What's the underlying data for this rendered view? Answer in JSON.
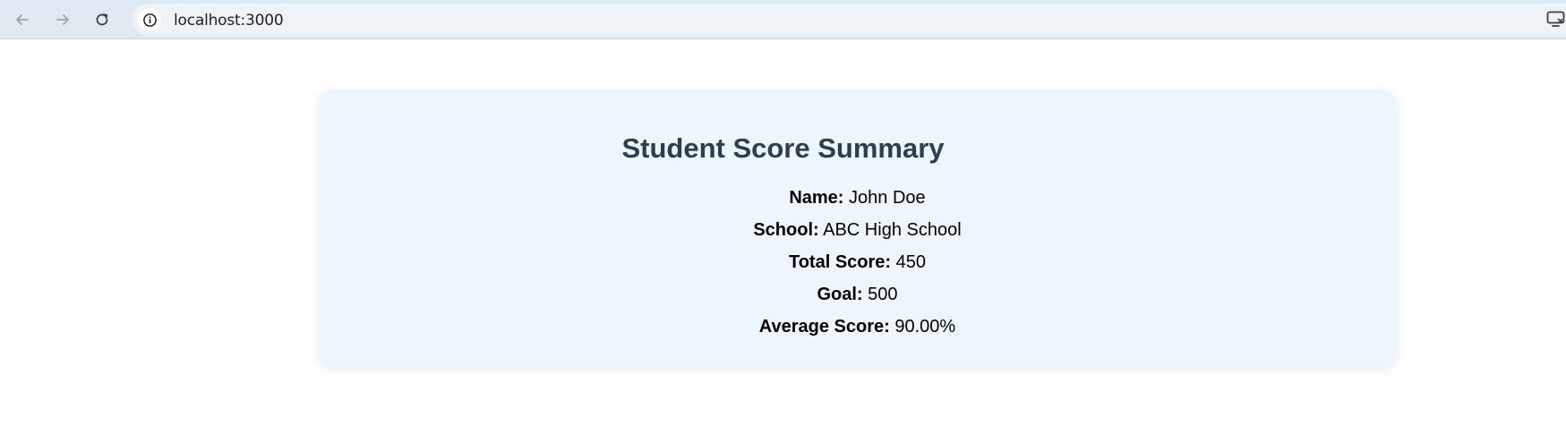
{
  "browser": {
    "url": "localhost:3000",
    "icons": {
      "back": "arrow-left-icon",
      "forward": "arrow-right-icon",
      "reload": "reload-icon",
      "site_info": "info-icon",
      "cast": "cast-icon"
    }
  },
  "card": {
    "title": "Student Score Summary",
    "rows": [
      {
        "label": "Name:",
        "value": "John Doe"
      },
      {
        "label": "School:",
        "value": "ABC High School"
      },
      {
        "label": "Total Score:",
        "value": "450"
      },
      {
        "label": "Goal:",
        "value": "500"
      },
      {
        "label": "Average Score:",
        "value": "90.00%"
      }
    ]
  },
  "colors": {
    "toolbar_bg": "#dee9f1",
    "card_bg": "#eef6fd",
    "title": "#2c3e50"
  }
}
